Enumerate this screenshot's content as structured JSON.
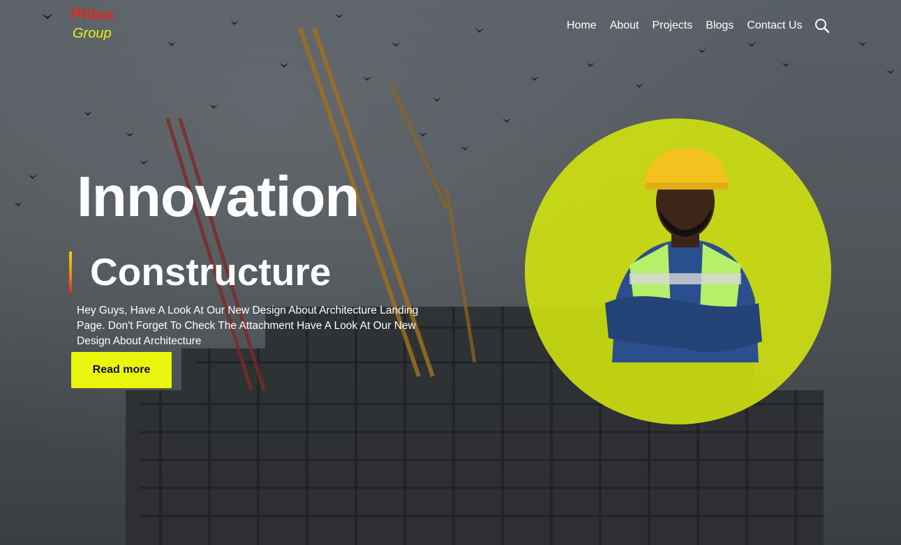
{
  "brand": {
    "name_top": "Phlox",
    "name_bottom": "Group"
  },
  "nav": {
    "items": [
      "Home",
      "About",
      "Projects",
      "Blogs",
      "Contact Us"
    ],
    "search_icon": "search-icon"
  },
  "hero": {
    "headline": "Innovation",
    "subheadline": "Constructure",
    "description": "Hey Guys, Have A Look At Our New Design About Architecture Landing Page. Don't Forget To Check The Attachment Have A Look At Our New Design About Architecture",
    "cta_label": "Read more"
  },
  "colors": {
    "brand_red": "#e3261b",
    "brand_yellow": "#e5f20f",
    "cta_bg": "#e9f50c",
    "circle_bg": "#d4e60e",
    "text": "#ffffff"
  }
}
